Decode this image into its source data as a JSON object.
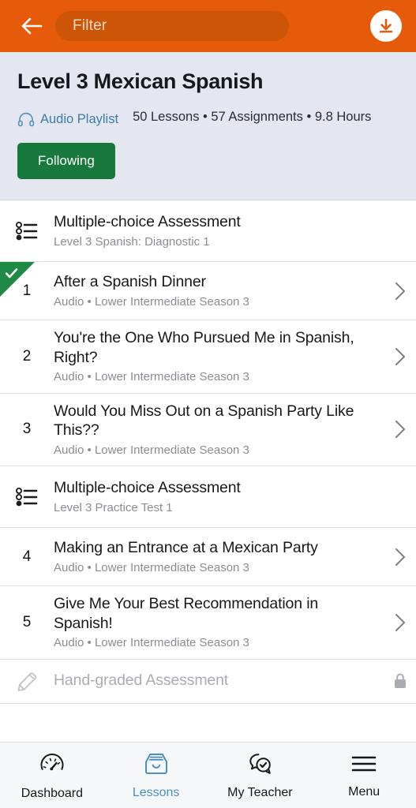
{
  "header": {
    "back_icon": "arrow-left-icon",
    "filter_placeholder": "Filter",
    "filter_value": "",
    "download_icon": "download-circle-icon",
    "accent_color": "#E55B0A",
    "field_color": "#CC5508"
  },
  "info": {
    "title": "Level 3 Mexican Spanish",
    "playlist_label": "Audio Playlist",
    "playlist_icon": "headphones-icon",
    "stats": "50 Lessons • 57 Assignments • 9.8 Hours",
    "lessons_count": "50 Lessons",
    "assignments_count": "57 Assignments",
    "hours": "9.8 Hours",
    "follow_label": "Following",
    "follow_color": "#17793C",
    "link_color": "#3F7CAC",
    "panel_color": "#E4E7EF"
  },
  "lessons": [
    {
      "kind": "assessment",
      "icon": "list-check-icon",
      "index": "",
      "title": "Multiple-choice Assessment",
      "subtitle": "Level 3 Spanish: Diagnostic 1",
      "completed": false,
      "locked": false,
      "chevron": false
    },
    {
      "kind": "lesson",
      "icon": "",
      "index": "1",
      "title": "After a Spanish Dinner",
      "subtitle": "Audio • Lower Intermediate Season 3",
      "completed": true,
      "locked": false,
      "chevron": true
    },
    {
      "kind": "lesson",
      "icon": "",
      "index": "2",
      "title": "You're the One Who Pursued Me in Spanish, Right?",
      "subtitle": "Audio • Lower Intermediate Season 3",
      "completed": false,
      "locked": false,
      "chevron": true
    },
    {
      "kind": "lesson",
      "icon": "",
      "index": "3",
      "title": "Would You Miss Out on a Spanish Party Like This??",
      "subtitle": "Audio • Lower Intermediate Season 3",
      "completed": false,
      "locked": false,
      "chevron": true
    },
    {
      "kind": "assessment",
      "icon": "list-check-icon",
      "index": "",
      "title": "Multiple-choice Assessment",
      "subtitle": "Level 3 Practice Test 1",
      "completed": false,
      "locked": false,
      "chevron": false
    },
    {
      "kind": "lesson",
      "icon": "",
      "index": "4",
      "title": "Making an Entrance at a Mexican Party",
      "subtitle": "Audio • Lower Intermediate Season 3",
      "completed": false,
      "locked": false,
      "chevron": true
    },
    {
      "kind": "lesson",
      "icon": "",
      "index": "5",
      "title": "Give Me Your Best Recommendation in Spanish!",
      "subtitle": "Audio • Lower Intermediate Season 3",
      "completed": false,
      "locked": false,
      "chevron": true
    },
    {
      "kind": "assessment",
      "icon": "pencil-icon",
      "index": "",
      "title": "Hand-graded Assessment",
      "subtitle": "",
      "completed": false,
      "locked": true,
      "chevron": false
    }
  ],
  "nav": {
    "items": [
      {
        "label": "Dashboard",
        "icon": "gauge-icon",
        "active": false
      },
      {
        "label": "Lessons",
        "icon": "inbox-smile-icon",
        "active": true
      },
      {
        "label": "My Teacher",
        "icon": "chat-check-icon",
        "active": false
      },
      {
        "label": "Menu",
        "icon": "hamburger-icon",
        "active": false
      }
    ],
    "active_color": "#4A90C4"
  }
}
